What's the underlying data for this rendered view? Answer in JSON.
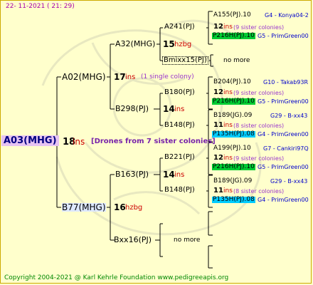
{
  "date": "22- 11-2021 ( 21: 29)",
  "footer": "Copyright 2004-2021 @ Karl Kehrle Foundation   www.pedigreeapis.org",
  "root": {
    "name": "A03(MHG)",
    "num": "18",
    "unit": "ins",
    "note": "[Drones from 7 sister colonies]"
  },
  "gen1": {
    "a02": {
      "name": "A02(MHG)",
      "num": "17",
      "unit": "ins",
      "note": "(1 single colony)"
    },
    "b77": {
      "name": "B77(MHG)",
      "num": "16",
      "unit": "hzbg"
    }
  },
  "gen2": {
    "a32": {
      "name": "A32(MHG)",
      "num": "15",
      "unit": "hzbg"
    },
    "b298": {
      "name": "B298(PJ)",
      "num": "14",
      "unit": "ins"
    },
    "b163": {
      "name": "B163(PJ)",
      "num": "14",
      "unit": "ins"
    },
    "bxx16": {
      "name": "Bxx16(PJ)",
      "more": "no more"
    }
  },
  "gen3": {
    "a241": "A241(PJ)",
    "bmixx15": {
      "name": "Bmixx15(PJ)",
      "more": "no more"
    },
    "b180": "B180(PJ)",
    "b148a": "B148(PJ)",
    "b221": "B221(PJ)",
    "b148b": "B148(PJ)"
  },
  "gen4": [
    {
      "id": "A155(PJ).10",
      "num": "12",
      "unit": "ins",
      "note": "(9 sister colonies)",
      "tag": "G4 - Konya04-2",
      "mark": "P216H(PJ).10",
      "mark_tag": "G5 - PrimGreen00",
      "mark_color": "green"
    },
    {
      "id": "B204(PJ).10",
      "num": "12",
      "unit": "ins",
      "note": "(9 sister colonies)",
      "tag": "G10 - Takab93R",
      "mark": "P216H(PJ).10",
      "mark_tag": "G5 - PrimGreen00",
      "mark_color": "green"
    },
    {
      "id": "B189(JG).09",
      "num": "11",
      "unit": "ins",
      "note": "(8 sister colonies)",
      "tag": "G29 - B-xx43",
      "mark": "P135H(PJ).08",
      "mark_tag": "G4 - PrimGreen00",
      "mark_color": "cyan"
    },
    {
      "id": "A199(PJ).10",
      "num": "12",
      "unit": "ins",
      "note": "(9 sister colonies)",
      "tag": "G7 - Cankiri97Q",
      "mark": "P216H(PJ).10",
      "mark_tag": "G5 - PrimGreen00",
      "mark_color": "green"
    },
    {
      "id": "B189(JG).09",
      "num": "11",
      "unit": "ins",
      "note": "(8 sister colonies)",
      "tag": "G29 - B-xx43",
      "mark": "P135H(PJ).08",
      "mark_tag": "G4 - PrimGreen00",
      "mark_color": "cyan"
    }
  ]
}
